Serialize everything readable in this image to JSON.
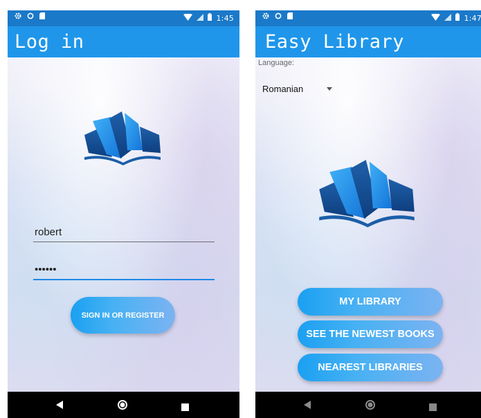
{
  "left_screen": {
    "status_time": "1:45",
    "app_title": "Log in",
    "username_value": "robert",
    "password_value": "••••••",
    "sign_in_label": "SIGN IN OR REGISTER"
  },
  "right_screen": {
    "status_time": "1:47",
    "app_title": "Easy Library",
    "language_label": "Language:",
    "language_value": "Romanian",
    "buttons": {
      "my_library": "MY LIBRARY",
      "newest_books": "SEE THE NEWEST BOOKS",
      "nearest_libraries": "NEAREST LIBRARIES"
    }
  },
  "colors": {
    "status_bar": "#1b79c9",
    "app_bar": "#1f96ea",
    "accent": "#1e88e5",
    "button_start": "#1aa0f2",
    "button_end": "#7cb3f1"
  },
  "icons": {
    "status_left": [
      "gear-icon",
      "circle-icon",
      "sd-card-icon"
    ],
    "status_right": [
      "wifi-icon",
      "signal-icon",
      "battery-icon"
    ],
    "nav": [
      "back-icon",
      "home-icon",
      "recents-icon"
    ]
  }
}
